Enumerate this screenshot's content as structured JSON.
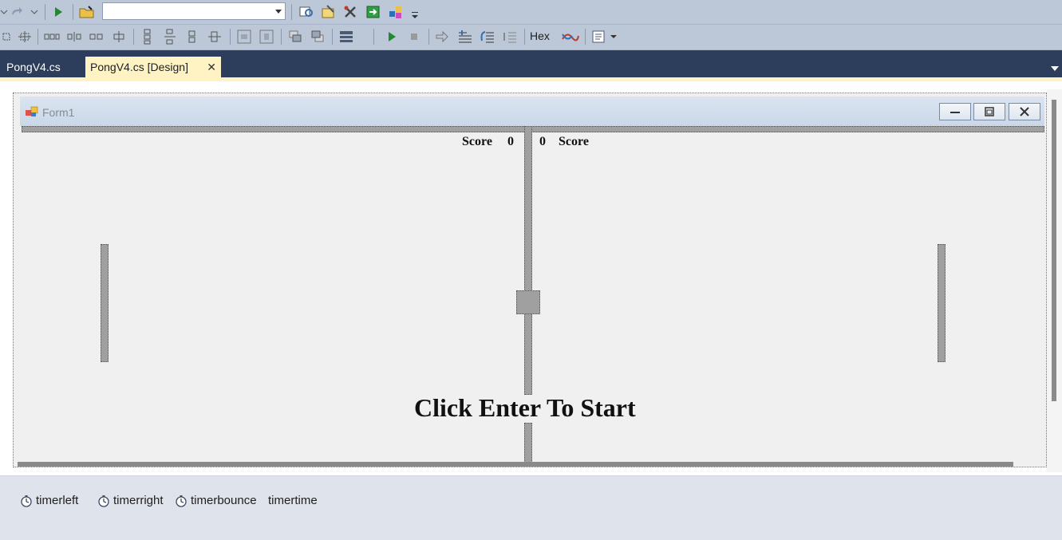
{
  "toolbar": {
    "config_combo_value": "",
    "hex_label": "Hex"
  },
  "tabs": [
    {
      "label": "PongV4.cs",
      "active": false
    },
    {
      "label": "PongV4.cs [Design]",
      "active": true
    }
  ],
  "tab_close_glyph": "✕",
  "form": {
    "title": "Form1"
  },
  "game": {
    "score_left_label": "Score",
    "score_left_value": "0",
    "score_right_value": "0",
    "score_right_label": "Score",
    "start_message": "Click Enter To Start"
  },
  "tray": {
    "components": [
      {
        "name": "timerleft",
        "icon": "stopwatch-icon"
      },
      {
        "name": "timerright",
        "icon": "stopwatch-icon"
      },
      {
        "name": "timerbounce",
        "icon": "stopwatch-icon"
      },
      {
        "name": "timertime",
        "icon": ""
      }
    ]
  },
  "colors": {
    "toolbar_bg": "#bcc7d8",
    "tabstrip_bg": "#2c3e5c",
    "active_tab_bg": "#fff3c4",
    "form_bg": "#f0f0f0"
  }
}
